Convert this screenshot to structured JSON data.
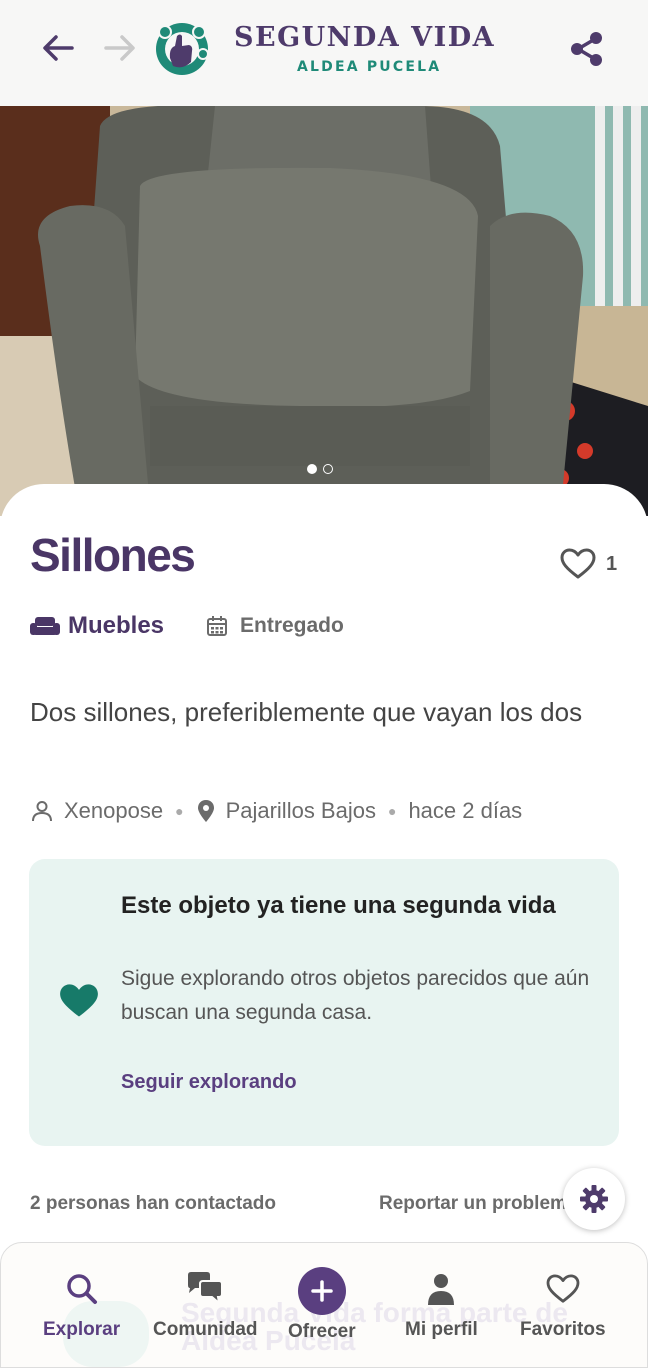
{
  "header": {
    "brand_title": "SEGUNDA VIDA",
    "brand_subtitle": "ALDEA PUCELA",
    "icons": [
      "arrow-left-icon",
      "arrow-right-icon",
      "logo",
      "share-icon"
    ]
  },
  "gallery": {
    "image_count": 2,
    "current_index": 1
  },
  "item": {
    "title": "Sillones",
    "favorites_count": "1",
    "category": "Muebles",
    "status": "Entregado",
    "description": "Dos sillones, preferiblemente que vayan los dos",
    "user": "Xenopose",
    "location": "Pajarillos Bajos",
    "time_ago": "hace 2 días"
  },
  "notice": {
    "title": "Este objeto ya tiene una segunda vida",
    "text": "Sigue explorando otros objetos parecidos que aún buscan una segunda casa.",
    "link": "Seguir explorando"
  },
  "footer": {
    "contacts": "2 personas han contactado",
    "report": "Reportar un problema"
  },
  "bottom_nav": {
    "watermark_line1": "Segunda Vida forma parte de",
    "watermark_line2": "Aldea Pucela",
    "items": [
      {
        "label": "Explorar",
        "icon": "search-icon",
        "active": true
      },
      {
        "label": "Comunidad",
        "icon": "chat-icon",
        "active": false
      },
      {
        "label": "Ofrecer",
        "icon": "plus-icon",
        "active": false
      },
      {
        "label": "Mi perfil",
        "icon": "user-icon",
        "active": false
      },
      {
        "label": "Favoritos",
        "icon": "heart-icon",
        "active": false
      }
    ]
  },
  "colors": {
    "brand_purple": "#4e3b6b",
    "accent_teal": "#1f8a78",
    "card_bg": "#e8f4f1"
  }
}
